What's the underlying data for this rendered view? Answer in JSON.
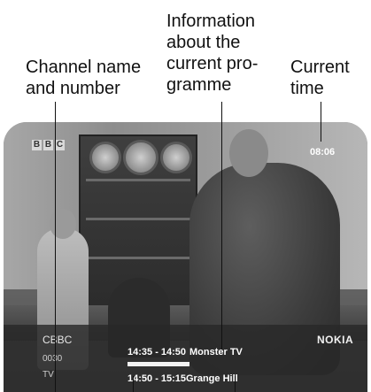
{
  "callouts": {
    "channel": "Channel name\nand number",
    "programme_info": "Information\nabout the\ncurrent pro-\ngramme",
    "current_time": "Current\ntime"
  },
  "screen": {
    "broadcaster_logo": [
      "B",
      "B",
      "C"
    ],
    "clock": "08:06",
    "banner": {
      "channel_name": "CBBC",
      "channel_number": "0030",
      "channel_type": "TV",
      "now": {
        "time": "14:35 - 14:50",
        "title": "Monster TV",
        "progress": 1.0
      },
      "next": {
        "time": "14:50 - 15:15",
        "title": "Grange Hill"
      },
      "brand": "NOKIA"
    }
  }
}
